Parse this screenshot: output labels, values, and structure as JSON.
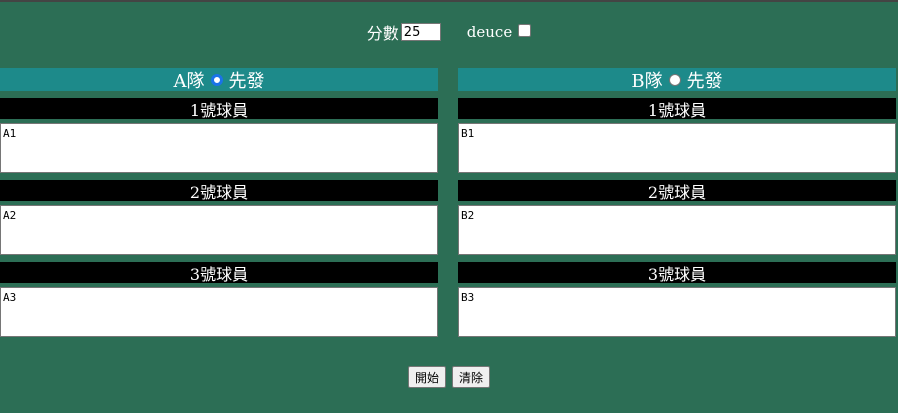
{
  "settings": {
    "score_label": "分數",
    "score_value": "25",
    "deuce_label": "deuce",
    "deuce_checked": false
  },
  "teams": [
    {
      "name": "A隊",
      "serve_label": "先發",
      "serve_selected": true,
      "players": [
        {
          "label": "1號球員",
          "value": "A1"
        },
        {
          "label": "2號球員",
          "value": "A2"
        },
        {
          "label": "3號球員",
          "value": "A3"
        }
      ]
    },
    {
      "name": "B隊",
      "serve_label": "先發",
      "serve_selected": false,
      "players": [
        {
          "label": "1號球員",
          "value": "B1"
        },
        {
          "label": "2號球員",
          "value": "B2"
        },
        {
          "label": "3號球員",
          "value": "B3"
        }
      ]
    }
  ],
  "actions": {
    "start_label": "開始",
    "clear_label": "清除"
  },
  "colors": {
    "background": "#2c6e55",
    "team_header": "#1d8a8a",
    "player_header": "#000000",
    "radio_selected": "#1a73e8"
  }
}
